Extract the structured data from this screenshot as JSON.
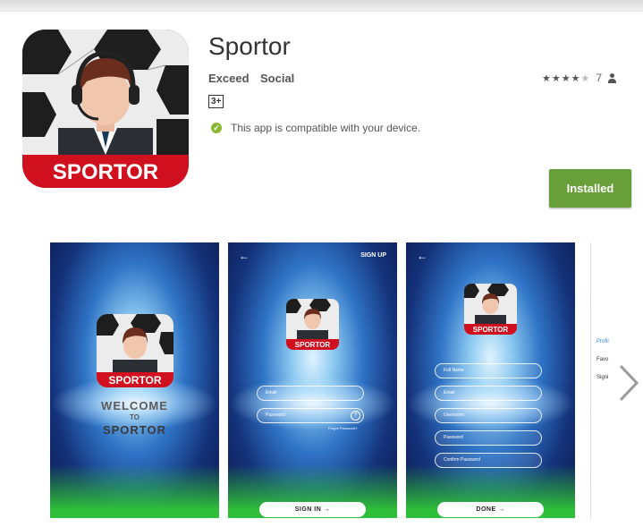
{
  "app": {
    "title": "Sportor",
    "developer": "Exceed",
    "category": "Social",
    "content_rating": "3+",
    "compatibility": "This app is compatible with your device.",
    "rating_count": "7",
    "stars_filled": 4,
    "install_label": "Installed",
    "icon_text": "SPORTOR"
  },
  "screenshots": {
    "welcome": {
      "line1": "WELCOME",
      "line2": "TO",
      "line3": "SPORTOR",
      "logo_text": "SPORTOR"
    },
    "signin": {
      "back": "←",
      "signup": "SIGN UP",
      "logo_text": "SPORTOR",
      "email_placeholder": "Email",
      "password_placeholder": "Password",
      "help": "?",
      "forgot": "Forgot Password?",
      "button": "SIGN IN  →"
    },
    "signup": {
      "back": "←",
      "logo_text": "SPORTOR",
      "fields": [
        "Full Name",
        "Email",
        "Username",
        "Password",
        "Confirm Password"
      ],
      "button": "DONE  →"
    },
    "partial": {
      "items": [
        "Profil",
        "Favo",
        "Signi"
      ]
    }
  },
  "colors": {
    "install_green": "#689f38",
    "brand_red": "#d0101f",
    "compat_green": "#8ab833"
  },
  "icons": [
    "check-circle-icon",
    "star-icon",
    "person-icon",
    "chevron-right-icon",
    "back-arrow-icon",
    "headset-icon"
  ]
}
